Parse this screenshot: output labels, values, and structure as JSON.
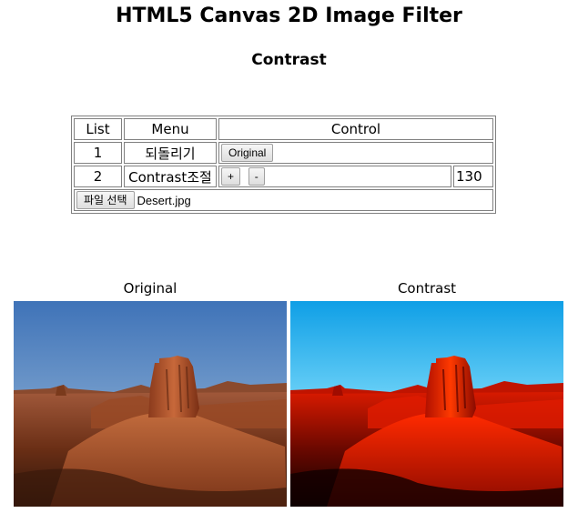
{
  "header": {
    "title": "HTML5 Canvas 2D Image Filter",
    "subtitle": "Contrast"
  },
  "table": {
    "headers": [
      "List",
      "Menu",
      "Control"
    ],
    "row1": {
      "num": "1",
      "menu": "되돌리기",
      "button": "Original"
    },
    "row2": {
      "num": "2",
      "menu": "Contrast조절",
      "plus": "+",
      "minus": "-",
      "value": "130"
    },
    "file": {
      "button": "파일 선택",
      "name": "Desert.jpg"
    }
  },
  "images": {
    "original_label": "Original",
    "contrast_label": "Contrast"
  },
  "colors": {
    "border": "#808080",
    "sky_original": "#4a7fc0",
    "sky_contrast": "#1aa8e8",
    "rock_original": "#b0502a",
    "rock_contrast": "#e81a00"
  }
}
